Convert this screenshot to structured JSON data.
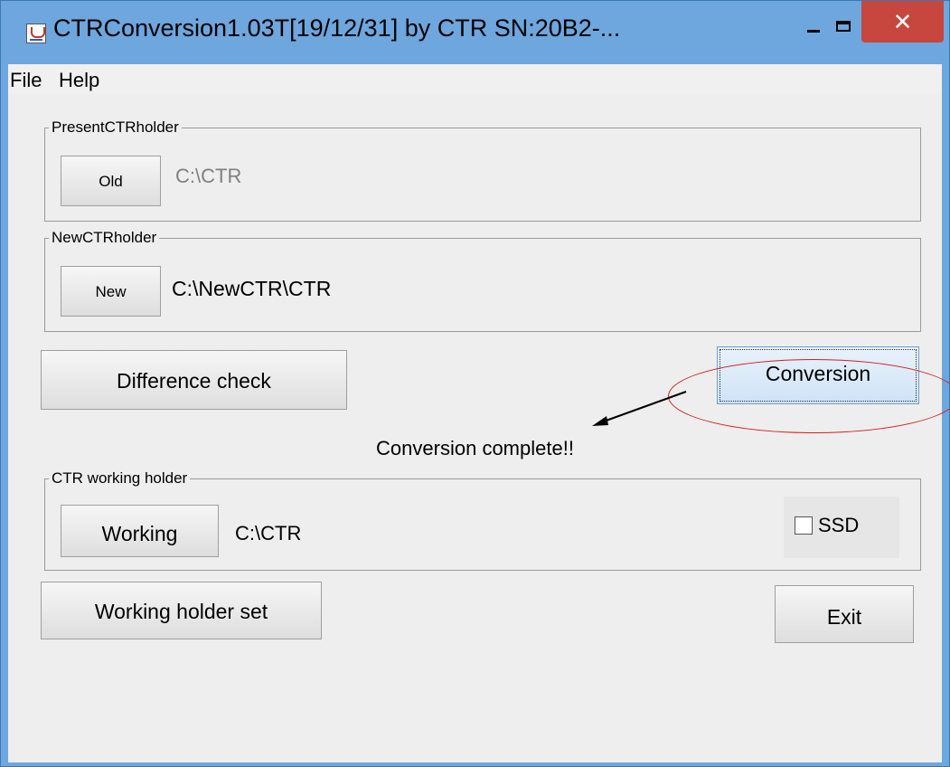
{
  "window": {
    "title": "CTRConversion1.03T[19/12/31] by CTR  SN:20B2-...",
    "close_glyph": "✕"
  },
  "menu": [
    "File",
    "Help"
  ],
  "present_group": {
    "label": "PresentCTRholder",
    "button": "Old",
    "path": "C:\\CTR"
  },
  "new_group": {
    "label": "NewCTRholder",
    "button": "New",
    "path": "C:\\NewCTR\\CTR"
  },
  "actions": {
    "difference_check": "Difference check",
    "conversion": "Conversion"
  },
  "status_message": "Conversion complete!!",
  "working_group": {
    "label": "CTR working holder",
    "button": "Working",
    "path": "C:\\CTR",
    "ssd_label": "SSD",
    "ssd_checked": false
  },
  "bottom": {
    "working_holder_set": "Working holder set",
    "exit": "Exit"
  },
  "colors": {
    "title_bar": "#6ea6de",
    "close_button": "#c7463e",
    "annotation": "#d61d1d",
    "disabled_text": "#808080"
  },
  "icons": [
    "java-app-icon",
    "minimize-icon",
    "maximize-icon",
    "close-icon",
    "arrow-icon"
  ]
}
